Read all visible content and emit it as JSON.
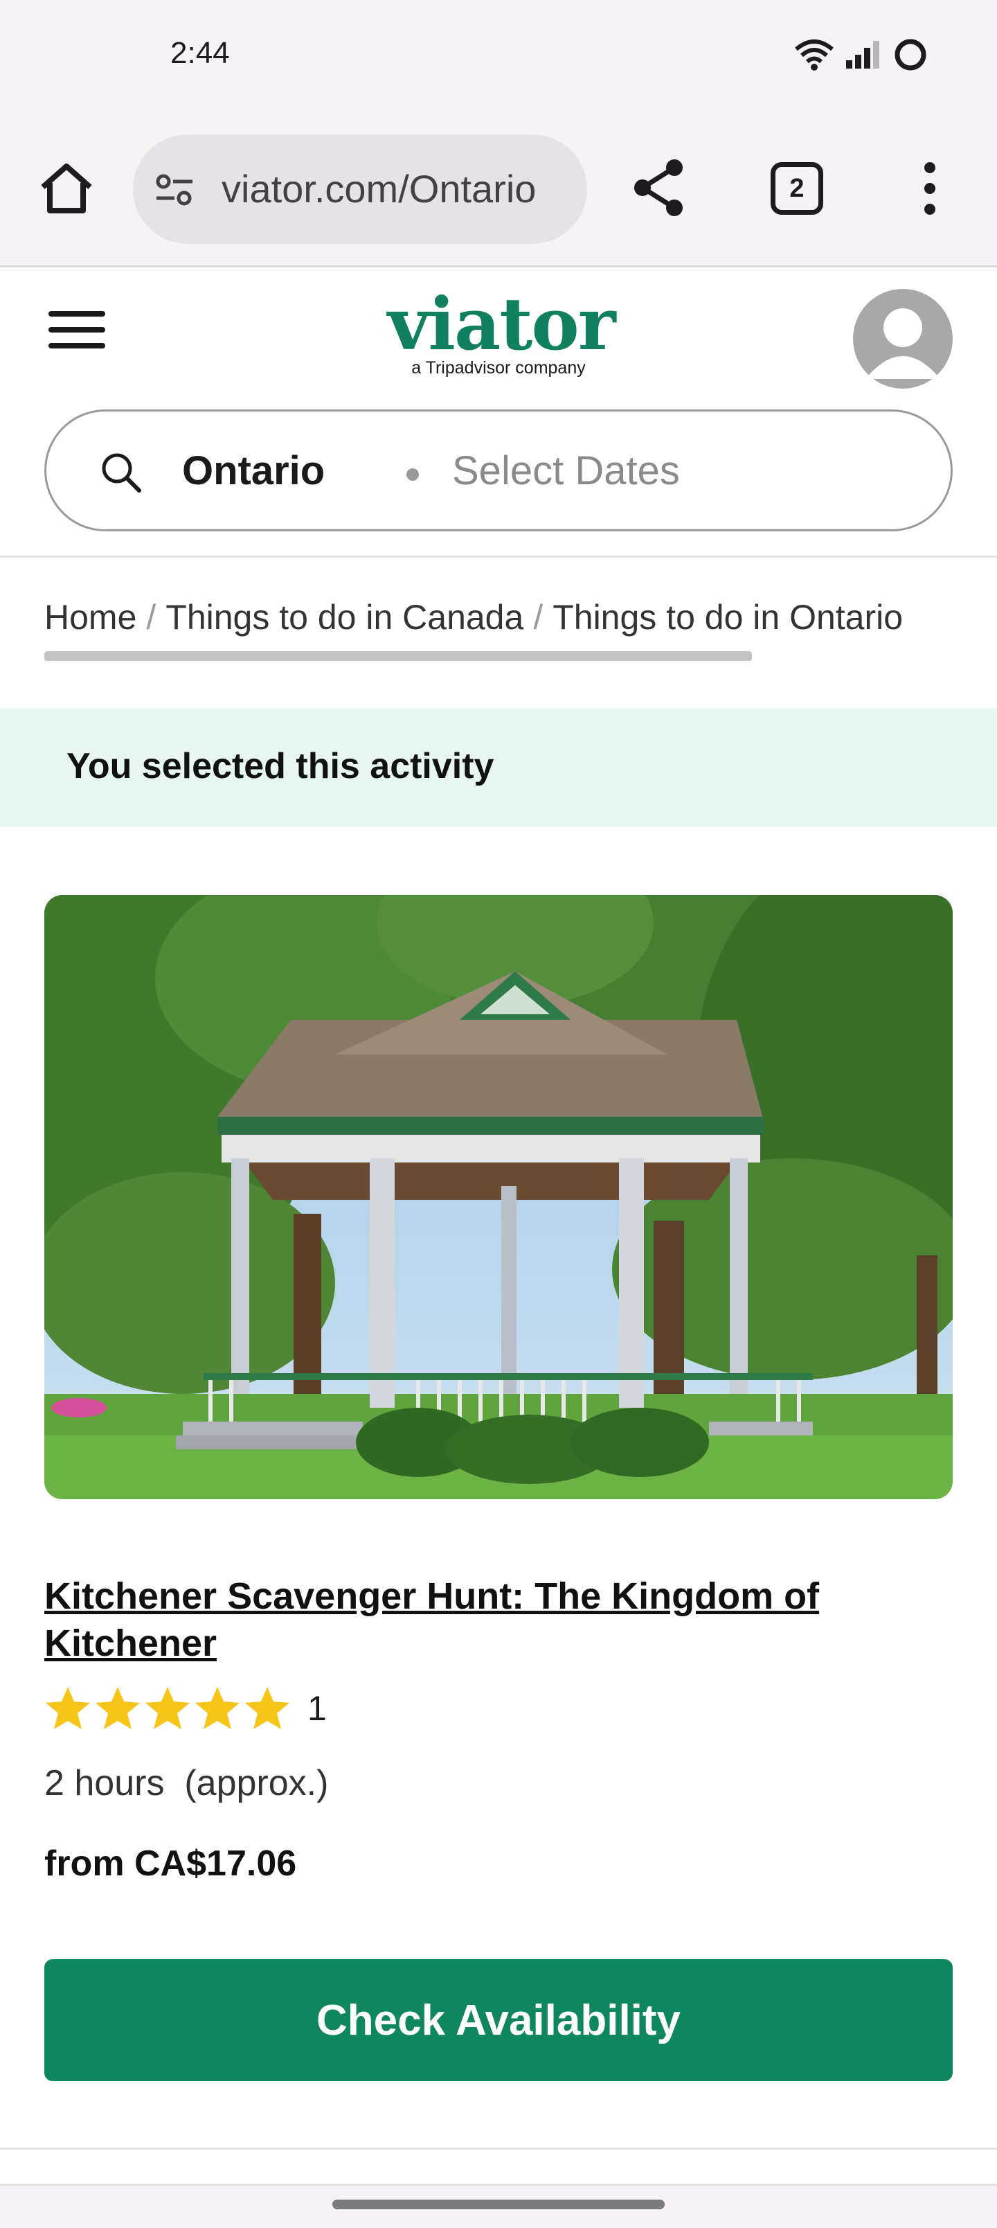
{
  "status_bar": {
    "time": "2:44"
  },
  "browser": {
    "url": "viator.com/Ontario",
    "tab_count": "2"
  },
  "header": {
    "logo_text": "viator",
    "logo_tagline": "a Tripadvisor company",
    "search": {
      "location": "Ontario",
      "dates_placeholder": "Select Dates"
    }
  },
  "breadcrumb": {
    "items": [
      "Home",
      "Things to do in Canada",
      "Things to do in Ontario"
    ],
    "separator": "/"
  },
  "banner": {
    "text": "You selected this activity"
  },
  "product": {
    "title": "Kitchener Scavenger Hunt: The Kingdom of Kitchener",
    "rating_stars": 5,
    "review_count": "1",
    "duration": "2 hours  (approx.)",
    "price": "from CA$17.06",
    "cta_label": "Check Availability"
  },
  "colors": {
    "brand": "#118060",
    "cta": "#0e8660",
    "banner_bg": "#e8f6f2",
    "star": "#f5c518"
  },
  "icons": [
    "wifi-icon",
    "signal-icon",
    "battery-icon",
    "home-icon",
    "site-settings-icon",
    "share-icon",
    "tabs-icon",
    "more-vert-icon",
    "hamburger-menu-icon",
    "avatar-icon",
    "search-icon",
    "star-icon"
  ]
}
